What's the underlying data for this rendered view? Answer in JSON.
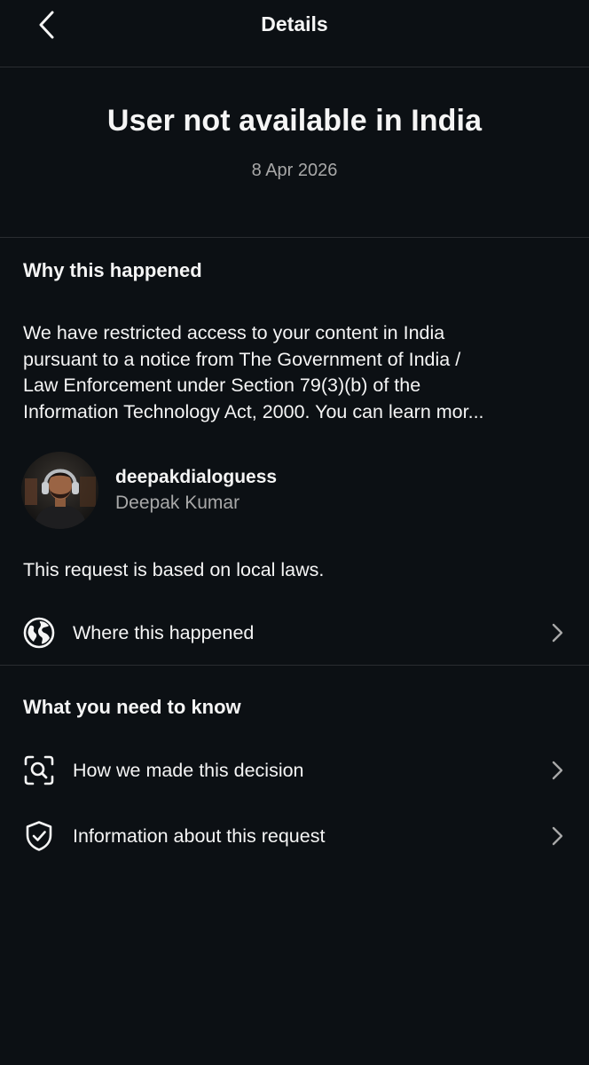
{
  "header": {
    "title": "Details"
  },
  "hero": {
    "title": "User not available in India",
    "date": "8 Apr 2026"
  },
  "why": {
    "heading": "Why this happened",
    "lines": [
      "We have restricted access to your content in India",
      "pursuant to a notice from The Government of India /",
      "Law Enforcement under Section 79(3)(b) of the",
      "Information Technology Act, 2000. You can learn mor..."
    ]
  },
  "account": {
    "username": "deepakdialoguess",
    "full_name": "Deepak Kumar"
  },
  "local_laws_text": "This request is based on local laws.",
  "where_row": {
    "label": "Where this happened",
    "icon": "globe-icon"
  },
  "know": {
    "heading": "What you need to know",
    "items": [
      {
        "label": "How we made this decision",
        "icon": "search-scan-icon"
      },
      {
        "label": "Information about this request",
        "icon": "shield-check-icon"
      }
    ]
  },
  "colors": {
    "background": "#0c1014",
    "text": "#f5f5f5",
    "secondary_text": "#a8a8a8",
    "divider": "#2a2d31"
  }
}
